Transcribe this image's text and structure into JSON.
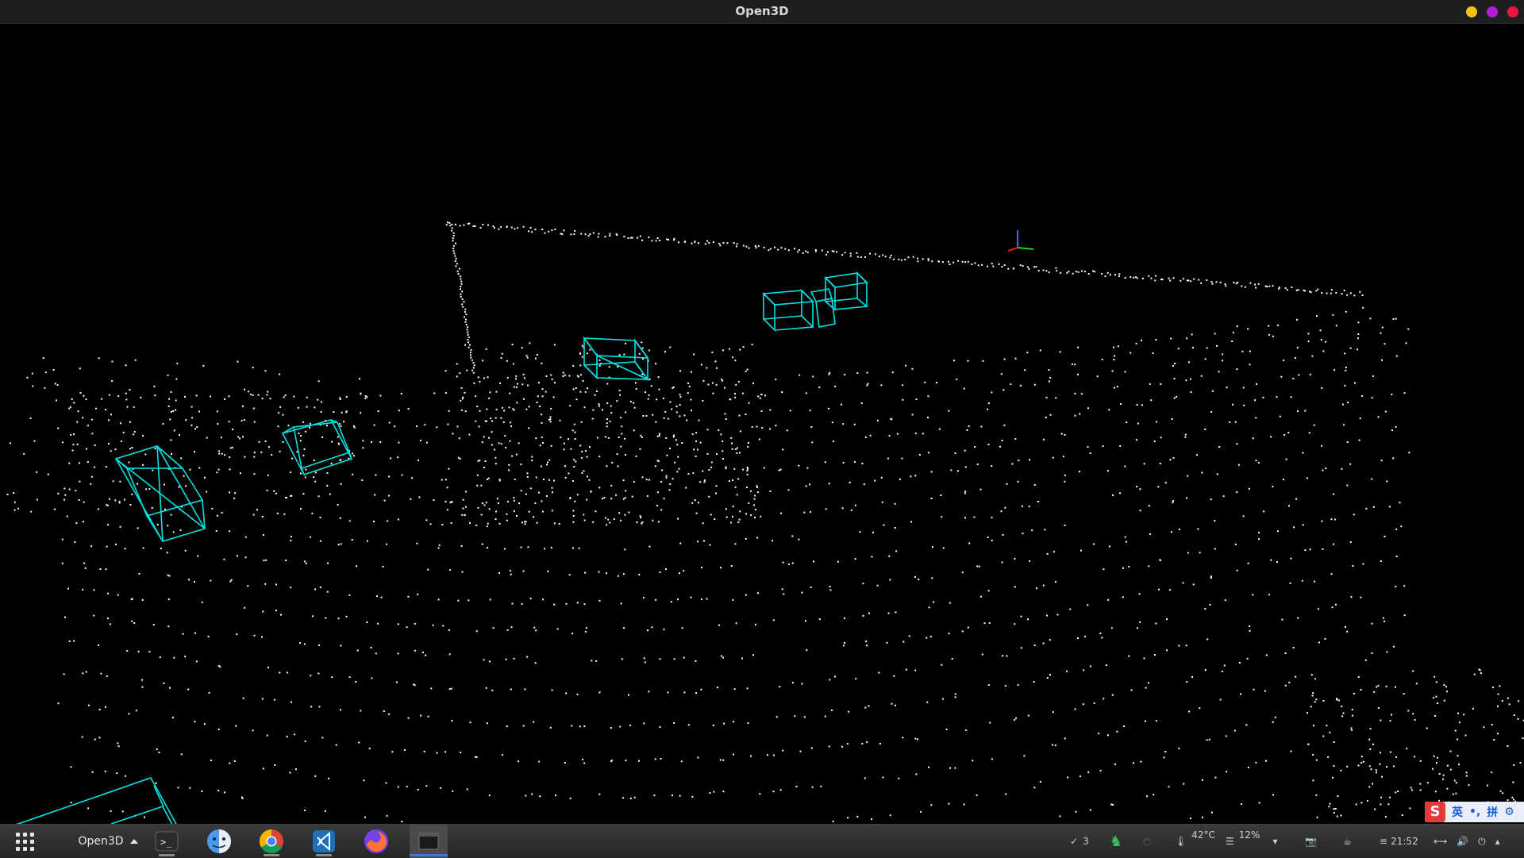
{
  "window": {
    "title": "Open3D",
    "buttons": [
      "minimize",
      "maximize",
      "close"
    ]
  },
  "viewport": {
    "content": "point-cloud",
    "bounding_box_color": "#00e5e5",
    "point_color": "#ffffff",
    "background": "#000000"
  },
  "ime": {
    "logo": "S",
    "lang": "英",
    "punct": "•,",
    "mode": "拼",
    "settings_icon": "gear-icon"
  },
  "taskbar": {
    "active_app_label": "Open3D",
    "dock": [
      "terminal",
      "finder",
      "chrome",
      "vscode",
      "firefox",
      "open3d-window"
    ],
    "tray": {
      "tasks_count": "3",
      "temperature": "42°C",
      "disk_usage": "12%",
      "clock": "21:52"
    }
  }
}
